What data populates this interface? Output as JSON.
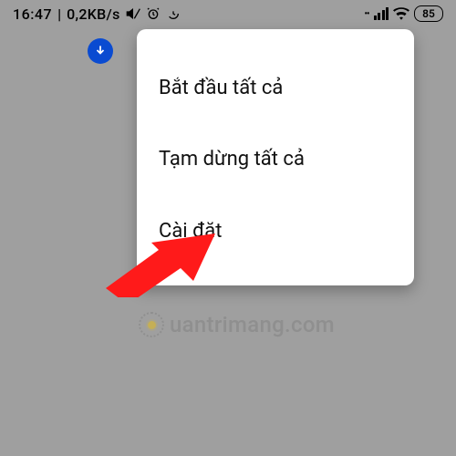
{
  "status_bar": {
    "time": "16:47",
    "separator": "|",
    "speed": "0,2KB/s",
    "battery": "85"
  },
  "menu": {
    "items": [
      {
        "label": "Bắt đầu tất cả"
      },
      {
        "label": "Tạm dừng tất cả"
      },
      {
        "label": "Cài đặt"
      }
    ]
  },
  "watermark": {
    "text": "uantrimang.com"
  },
  "colors": {
    "background": "#9f9f9f",
    "download_badge": "#0a4bd1",
    "arrow": "#ff1a1a"
  }
}
